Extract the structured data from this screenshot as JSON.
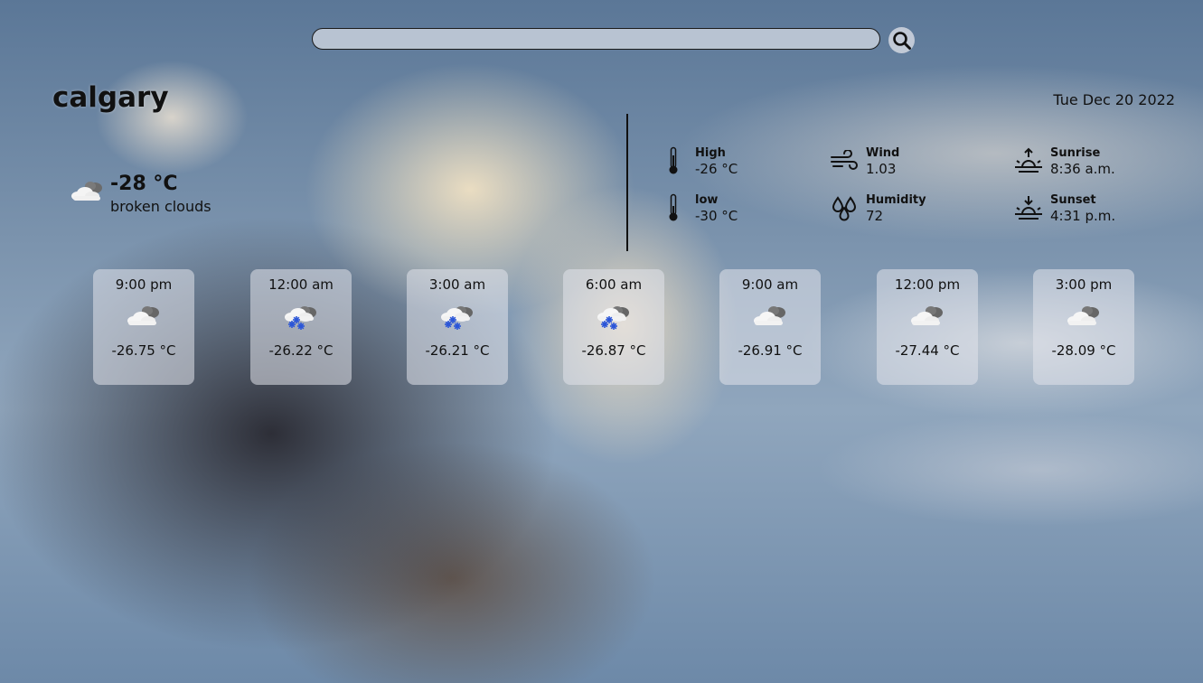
{
  "search": {
    "value": "",
    "placeholder": ""
  },
  "location": {
    "city": "calgary"
  },
  "date": "Tue Dec 20 2022",
  "current": {
    "temp": "-28 °C",
    "description": "broken clouds",
    "icon": "broken-clouds-icon"
  },
  "details": {
    "high": {
      "label": "High",
      "value": "-26 °C",
      "icon": "thermometer-icon"
    },
    "low": {
      "label": "low",
      "value": "-30 °C",
      "icon": "thermometer-icon"
    },
    "wind": {
      "label": "Wind",
      "value": "1.03",
      "icon": "wind-icon"
    },
    "humidity": {
      "label": "Humidity",
      "value": "72",
      "icon": "humidity-drops-icon"
    },
    "sunrise": {
      "label": "Sunrise",
      "value": "8:36 a.m.",
      "icon": "sunrise-icon"
    },
    "sunset": {
      "label": "Sunset",
      "value": "4:31 p.m.",
      "icon": "sunset-icon"
    }
  },
  "forecast": [
    {
      "time": "9:00 pm",
      "temp": "-26.75 °C",
      "icon": "broken-clouds-icon"
    },
    {
      "time": "12:00 am",
      "temp": "-26.22 °C",
      "icon": "snow-icon"
    },
    {
      "time": "3:00 am",
      "temp": "-26.21 °C",
      "icon": "snow-icon"
    },
    {
      "time": "6:00 am",
      "temp": "-26.87 °C",
      "icon": "snow-icon"
    },
    {
      "time": "9:00 am",
      "temp": "-26.91 °C",
      "icon": "broken-clouds-icon"
    },
    {
      "time": "12:00 pm",
      "temp": "-27.44 °C",
      "icon": "broken-clouds-icon"
    },
    {
      "time": "3:00 pm",
      "temp": "-28.09 °C",
      "icon": "broken-clouds-icon"
    }
  ],
  "colors": {
    "text": "#111111",
    "snowflake": "#2a55d8",
    "card": "#e1e4eb"
  }
}
